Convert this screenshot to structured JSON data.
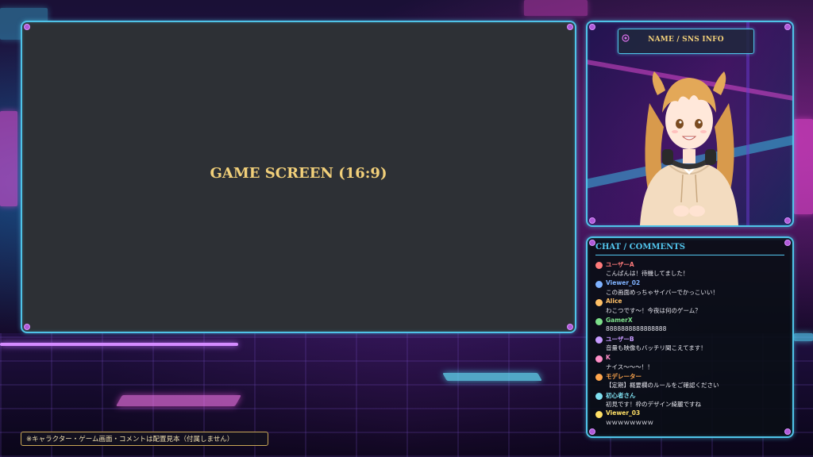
{
  "game_screen": {
    "label": "GAME SCREEN (16:9)"
  },
  "character_panel": {
    "name_label": "NAME / SNS INFO",
    "icon": "sns-icon"
  },
  "chat": {
    "header": "CHAT / COMMENTS",
    "comments": [
      {
        "user": "ユーザーA",
        "message": "こんばんは！待機してました！",
        "color": "#ff7b7b"
      },
      {
        "user": "Viewer_02",
        "message": "この画面めっちゃサイバーでかっこいい！",
        "color": "#7fb2ff"
      },
      {
        "user": "Alice",
        "message": "わこつです〜！今夜は何のゲーム？",
        "color": "#ffc066"
      },
      {
        "user": "GamerX",
        "message": "8888888888888888",
        "color": "#7de08a"
      },
      {
        "user": "ユーザーB",
        "message": "音量も映像もバッチリ聞こえてます！",
        "color": "#c79bff"
      },
      {
        "user": "K",
        "message": "ナイス〜〜〜！！",
        "color": "#ff8fc8"
      },
      {
        "user": "モデレーター",
        "message": "【定期】概要欄のルールをご確認ください",
        "color": "#ffa64d"
      },
      {
        "user": "初心者さん",
        "message": "初見です！枠のデザイン綺麗ですね",
        "color": "#7fe0f0"
      },
      {
        "user": "Viewer_03",
        "message": "ｗｗｗｗｗｗｗｗ",
        "color": "#ffe066"
      }
    ]
  },
  "footnote": {
    "text": "※キャラクター・ゲーム画面・コメントは配置見本（付属しません）"
  },
  "colors": {
    "frame": "#4fc3e8",
    "accent_gold": "#f2d07a",
    "corner": "#b05ad8"
  }
}
